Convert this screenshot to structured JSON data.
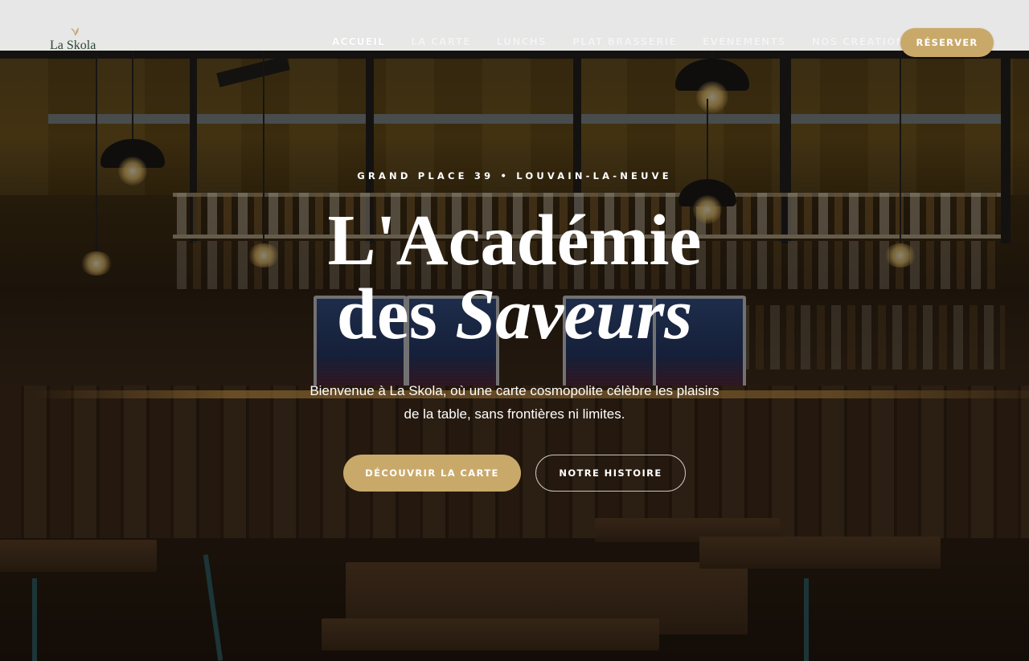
{
  "brand": {
    "name": "La Skola"
  },
  "nav": {
    "items": [
      {
        "label": "ACCUEIL",
        "active": true
      },
      {
        "label": "LA CARTE",
        "active": false
      },
      {
        "label": "LUNCHS",
        "active": false
      },
      {
        "label": "PLAT BRASSERIE",
        "active": false
      },
      {
        "label": "ÉVÉNEMENTS",
        "active": false
      },
      {
        "label": "NOS CRÉATIONS",
        "active": false
      }
    ],
    "reserve_label": "RÉSERVER"
  },
  "hero": {
    "subtitle": "GRAND PLACE 39 • LOUVAIN-LA-NEUVE",
    "title_line1": "L'Académie",
    "title_line2_plain": "des ",
    "title_line2_italic": "Saveurs",
    "description": "Bienvenue à La Skola, où une carte cosmopolite célèbre les plaisirs de la table, sans frontières ni limites.",
    "primary_button": "DÉCOUVRIR LA CARTE",
    "secondary_button": "NOTRE HISTOIRE"
  },
  "colors": {
    "accent": "#c9a96a",
    "header_bg": "#eeeeee",
    "logo_text": "#2c4633"
  },
  "icons": {
    "logo_mark": "leaf-icon"
  }
}
